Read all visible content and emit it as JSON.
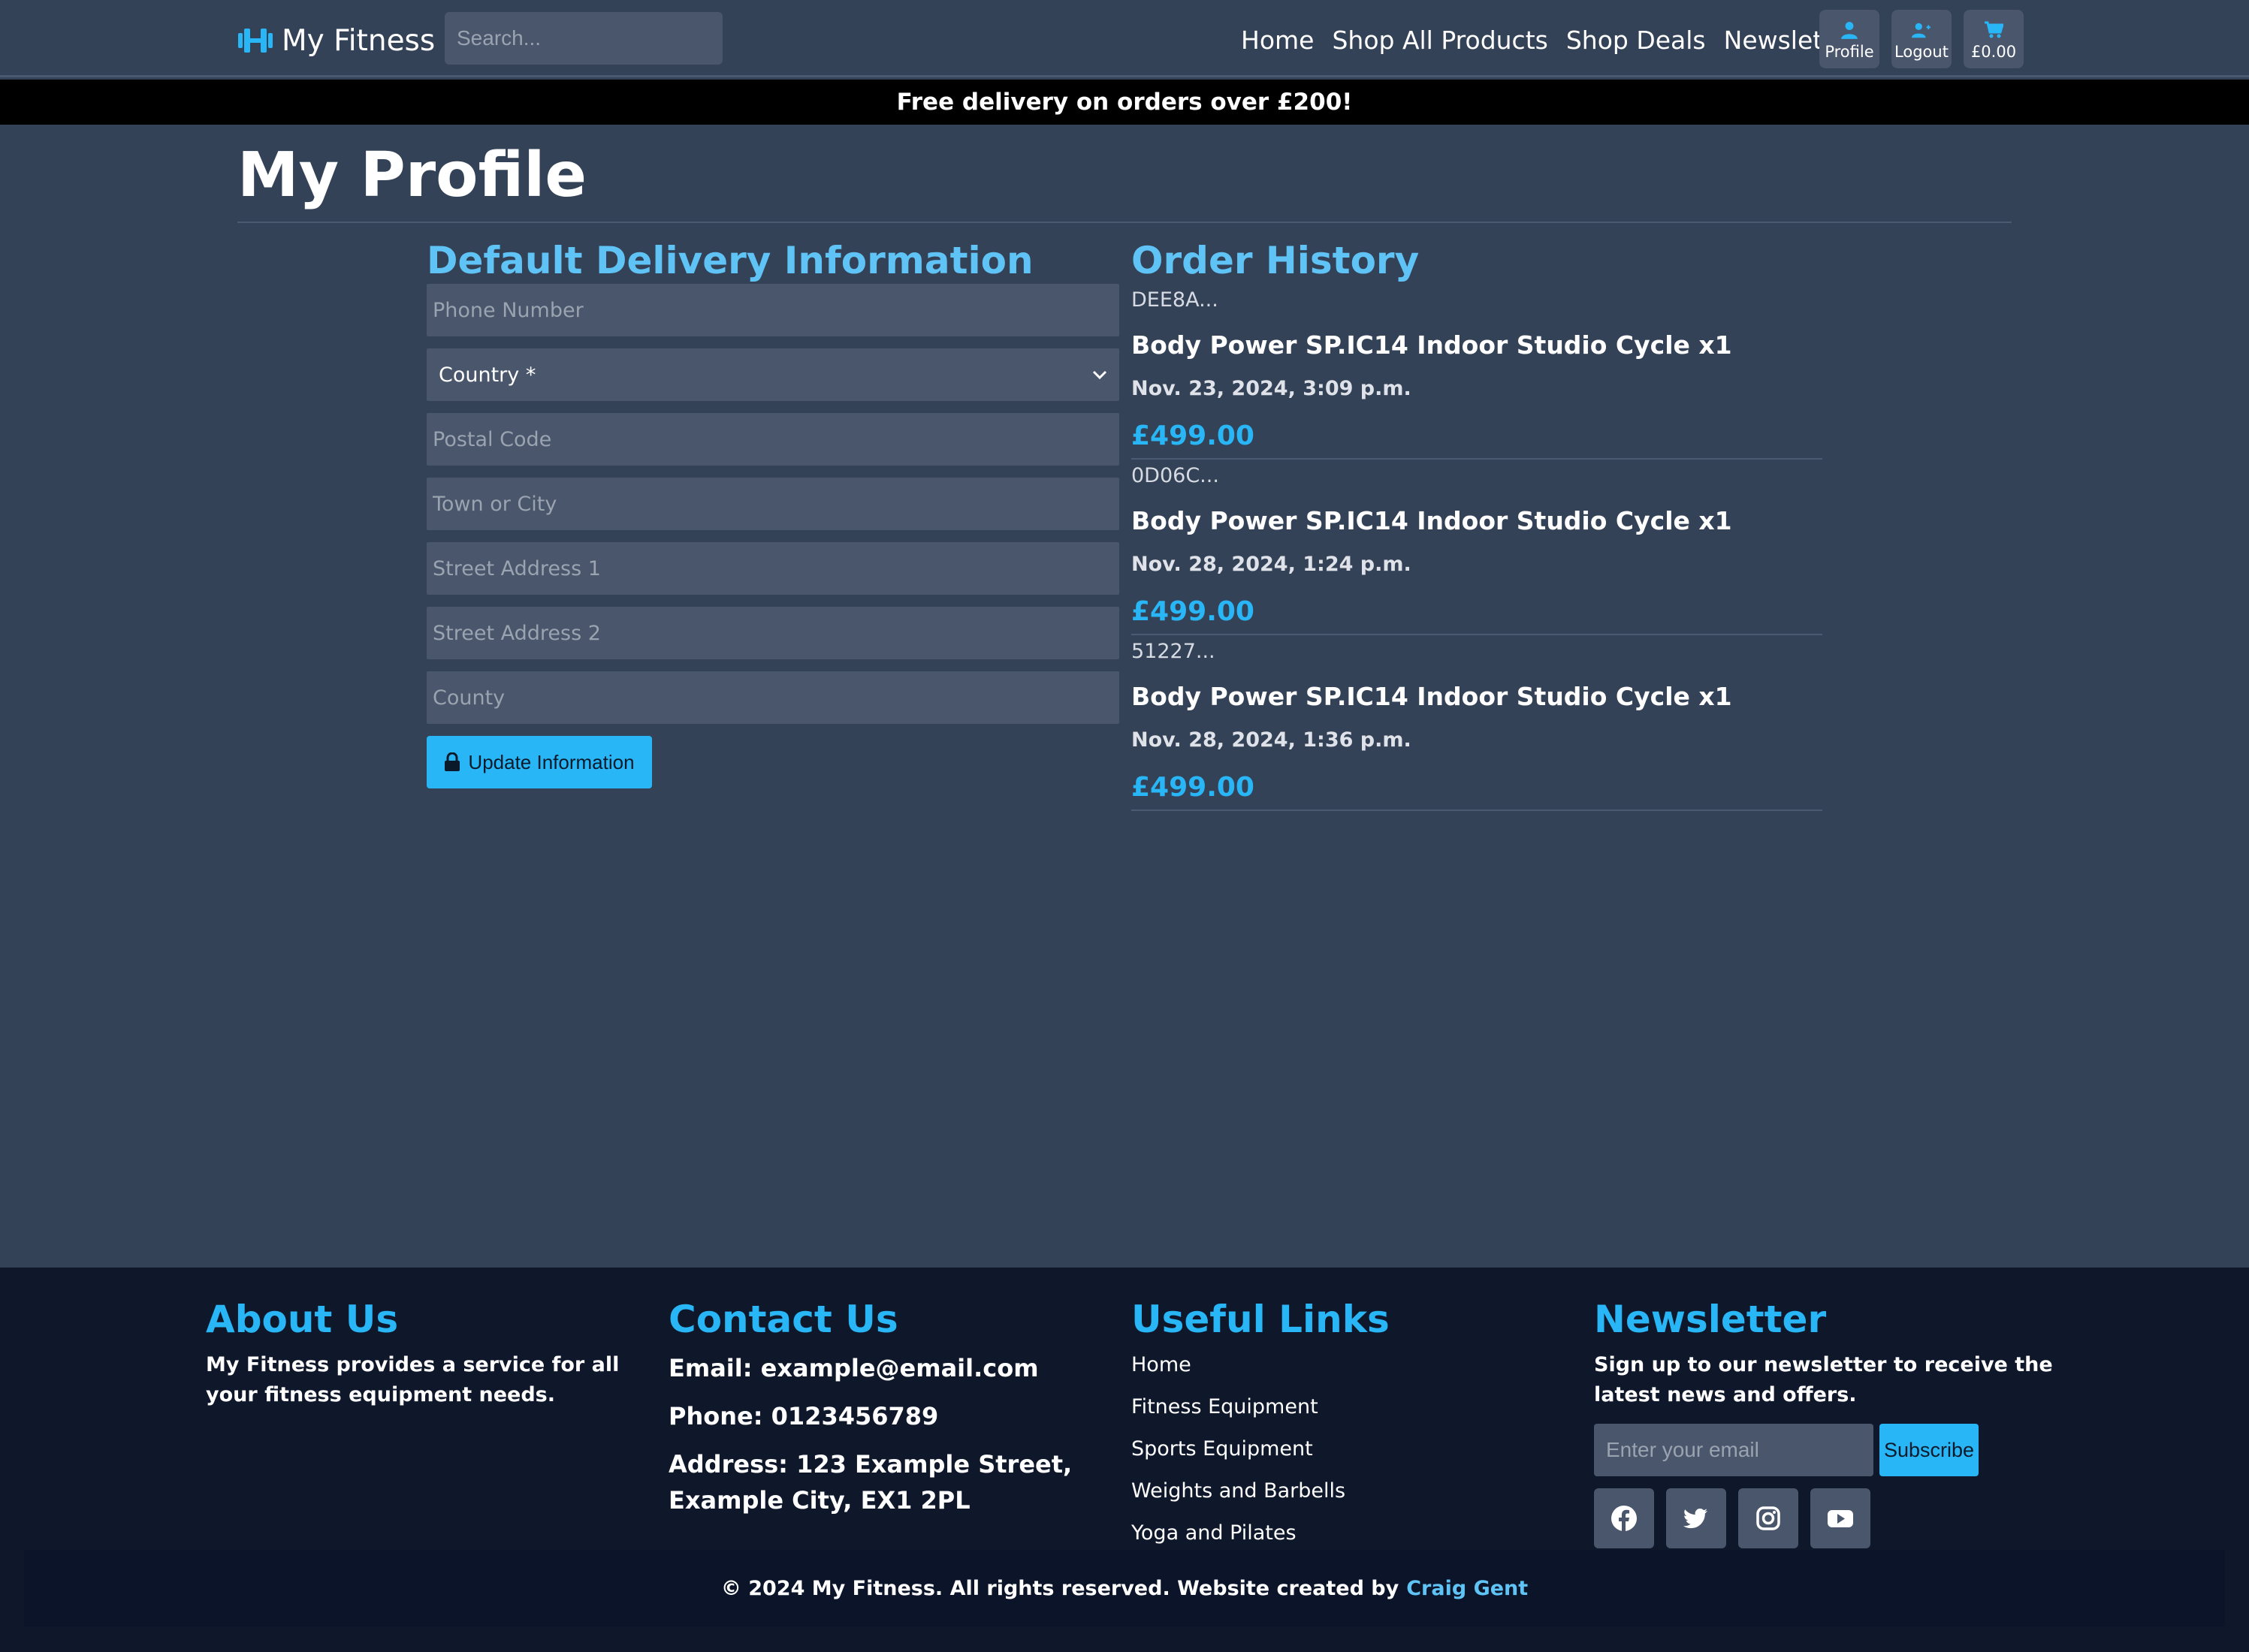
{
  "header": {
    "brand": "My Fitness",
    "search_placeholder": "Search...",
    "nav": [
      "Home",
      "Shop All Products",
      "Shop Deals",
      "Newsletter"
    ],
    "profile_label": "Profile",
    "logout_label": "Logout",
    "cart_total": "£0.00"
  },
  "banner": "Free delivery on orders over £200!",
  "main": {
    "title": "My Profile",
    "delivery": {
      "heading": "Default Delivery Information",
      "phone_placeholder": "Phone Number",
      "country_selected": "Country *",
      "postal_placeholder": "Postal Code",
      "town_placeholder": "Town or City",
      "street1_placeholder": "Street Address 1",
      "street2_placeholder": "Street Address 2",
      "county_placeholder": "County",
      "update_label": "Update Information"
    },
    "orders": {
      "heading": "Order History",
      "items": [
        {
          "id": "DEE8A...",
          "item": "Body Power SP.IC14 Indoor Studio Cycle x1",
          "date": "Nov. 23, 2024, 3:09 p.m.",
          "price": "£499.00"
        },
        {
          "id": "0D06C...",
          "item": "Body Power SP.IC14 Indoor Studio Cycle x1",
          "date": "Nov. 28, 2024, 1:24 p.m.",
          "price": "£499.00"
        },
        {
          "id": "51227...",
          "item": "Body Power SP.IC14 Indoor Studio Cycle x1",
          "date": "Nov. 28, 2024, 1:36 p.m.",
          "price": "£499.00"
        }
      ]
    }
  },
  "footer": {
    "about": {
      "heading": "About Us",
      "text": "My Fitness provides a service for all your fitness equipment needs."
    },
    "contact": {
      "heading": "Contact Us",
      "email": "Email: example@email.com",
      "phone": "Phone: 0123456789",
      "address": "Address: 123 Example Street, Example City, EX1 2PL"
    },
    "links": {
      "heading": "Useful Links",
      "items": [
        "Home",
        "Fitness Equipment",
        "Sports Equipment",
        "Weights and Barbells",
        "Yoga and Pilates"
      ]
    },
    "newsletter": {
      "heading": "Newsletter",
      "text": "Sign up to our newsletter to receive the latest news and offers.",
      "email_placeholder": "Enter your email",
      "subscribe_label": "Subscribe",
      "social_icons": [
        "facebook-icon",
        "twitter-icon",
        "instagram-icon",
        "youtube-icon"
      ]
    },
    "copyright": "© 2024 My Fitness. All rights reserved.  Website created by",
    "author": "Craig Gent"
  },
  "colors": {
    "accent": "#29b6f6",
    "heading_blue": "#5fc3f5",
    "page_bg": "#344257",
    "footer_bg": "#0f172a"
  }
}
